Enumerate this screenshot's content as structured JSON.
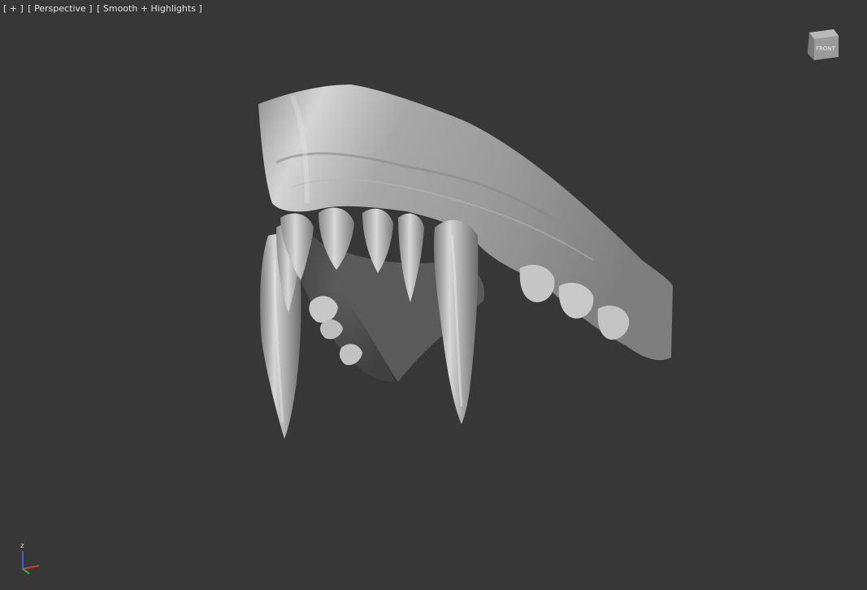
{
  "viewport": {
    "label_menu": "[ + ]",
    "label_view": "[ Perspective ]",
    "label_shading": "[ Smooth + Highlights ]"
  },
  "viewcube": {
    "face_label": "FRONT",
    "icon": "viewcube-icon"
  },
  "axis_tripod": {
    "z_label": "z",
    "icon": "axis-tripod-icon",
    "colors": {
      "x": "#d23a2a",
      "y": "#2fb84a",
      "z": "#3a5fe0"
    }
  },
  "colors": {
    "background": "#373737",
    "model_light": "#c9c9c9",
    "model_mid": "#9a9a9a",
    "model_dark": "#5a5a5a",
    "label_text": "#e3e3e3"
  }
}
